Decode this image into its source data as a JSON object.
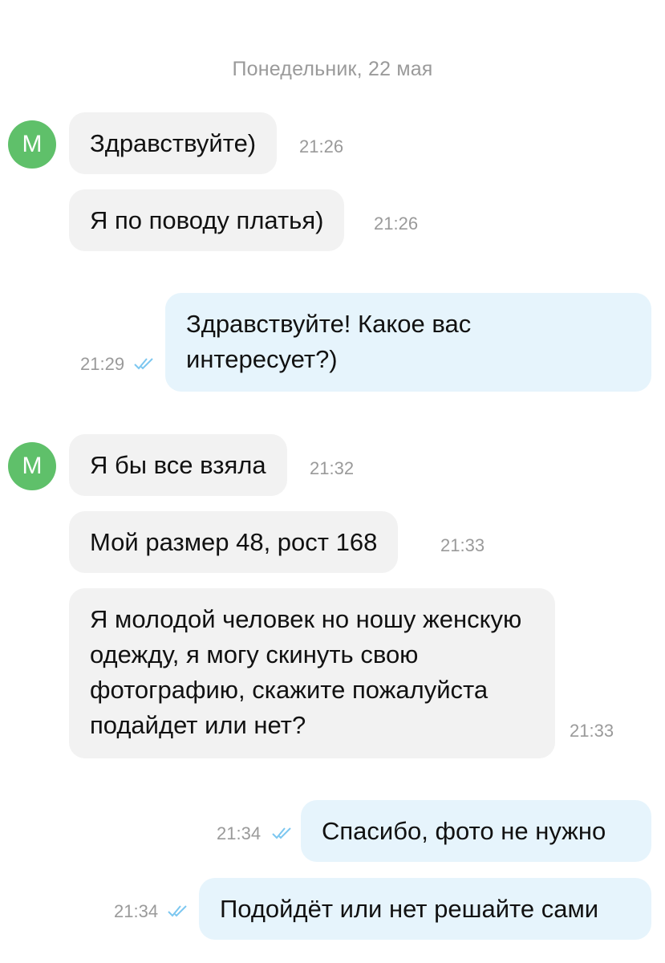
{
  "date_separator": "Понедельник, 22 мая",
  "avatar_letter": "М",
  "colors": {
    "incoming_bubble": "#f2f2f2",
    "outgoing_bubble": "#e6f4fc",
    "avatar": "#5fc06a",
    "read_check": "#7cc7f0"
  },
  "messages": [
    {
      "direction": "in",
      "text": "Здравствуйте)",
      "time": "21:26"
    },
    {
      "direction": "in",
      "text": "Я по поводу платья)",
      "time": "21:26"
    },
    {
      "direction": "out",
      "text": "Здравствуйте! Какое вас интересует?)",
      "time": "21:29",
      "status": "read-double-check-icon"
    },
    {
      "direction": "in",
      "text": "Я бы все взяла",
      "time": "21:32"
    },
    {
      "direction": "in",
      "text": "Мой размер 48, рост 168",
      "time": "21:33"
    },
    {
      "direction": "in",
      "text": "Я молодой человек но ношу женскую одежду, я могу скинуть свою фотографию, скажите пожалуйста подайдет или нет?",
      "time": "21:33"
    },
    {
      "direction": "out",
      "text": "Спасибо, фото не нужно",
      "time": "21:34",
      "status": "read-double-check-icon"
    },
    {
      "direction": "out",
      "text": "Подойдёт или нет решайте сами",
      "time": "21:34",
      "status": "read-double-check-icon"
    }
  ]
}
